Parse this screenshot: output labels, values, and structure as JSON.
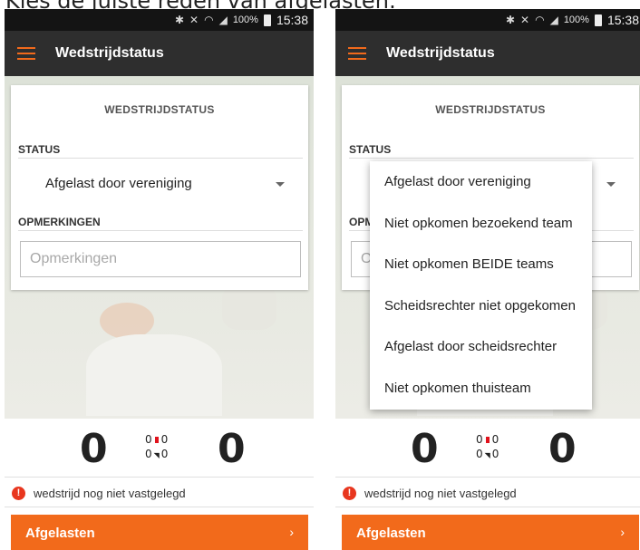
{
  "caption": "Kies de juiste reden van afgelasten:",
  "statusbar": {
    "battery_label": "100%",
    "time": "15:38"
  },
  "appbar": {
    "title": "Wedstrijdstatus"
  },
  "card": {
    "title": "WEDSTRIJDSTATUS",
    "status_label": "STATUS",
    "status_value": "Afgelast door vereniging",
    "remarks_label": "OPMERKINGEN",
    "remarks_label_truncated": "OPM",
    "remarks_placeholder": "Opmerkingen",
    "remarks_placeholder_truncated": "O"
  },
  "score": {
    "home": "0",
    "away": "0",
    "cards_home": "0",
    "cards_away": "0",
    "shoes_home": "0",
    "shoes_away": "0"
  },
  "warning": {
    "text": "wedstrijd nog niet vastgelegd"
  },
  "action": {
    "label": "Afgelasten",
    "chevron": "›"
  },
  "dropdown": {
    "options": [
      "Afgelast door vereniging",
      "Niet opkomen bezoekend team",
      "Niet opkomen BEIDE teams",
      "Scheidsrechter niet opgekomen",
      "Afgelast door scheidsrechter",
      "Niet opkomen thuisteam"
    ]
  },
  "colors": {
    "accent": "#f26a1b",
    "appbar": "#2e2e2e",
    "statusbar": "#141414",
    "warning": "#e8361e"
  },
  "icons": {
    "menu": "hamburger-menu-icon",
    "bluetooth": "bluetooth-icon",
    "mute": "mute-icon",
    "wifi": "wifi-icon",
    "signal": "signal-icon",
    "battery": "battery-icon",
    "dropdown": "caret-down-icon",
    "warning": "alert-circle-icon",
    "chevron": "chevron-right-icon"
  }
}
